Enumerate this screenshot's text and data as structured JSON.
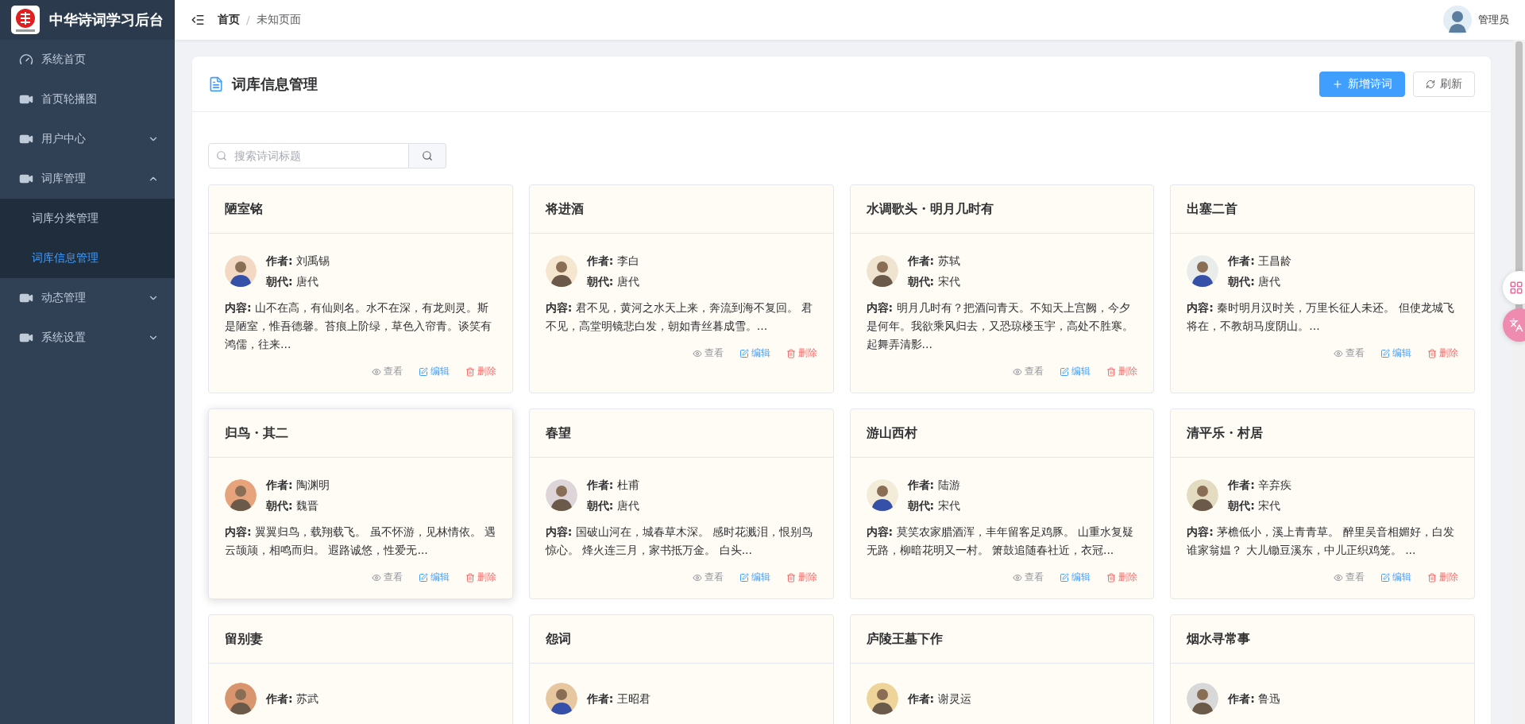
{
  "sidebar": {
    "logo_text": "中华诗词学习后台",
    "items": [
      {
        "label": "系统首页",
        "selected": false
      },
      {
        "label": "首页轮播图",
        "selected": false
      },
      {
        "label": "用户中心",
        "expanded": false,
        "selected": false
      },
      {
        "label": "词库管理",
        "expanded": true,
        "selected": false,
        "children": [
          {
            "label": "词库分类管理",
            "selected": false
          },
          {
            "label": "词库信息管理",
            "selected": true
          }
        ]
      },
      {
        "label": "动态管理",
        "expanded": false,
        "selected": false
      },
      {
        "label": "系统设置",
        "expanded": false,
        "selected": false
      }
    ]
  },
  "header": {
    "breadcrumb": [
      "首页",
      "未知页面"
    ],
    "separator": "/",
    "user": "管理员"
  },
  "panel": {
    "title": "词库信息管理",
    "buttons": [
      {
        "kind": "primary",
        "label": "新增诗词"
      },
      {
        "kind": "default",
        "label": "刷新"
      }
    ],
    "search": {
      "placeholder": "搜索诗词标题"
    },
    "cards": [
      {
        "title": "陋室铭",
        "hovered": false,
        "author": "**作者:** 刘禹锡",
        "dynasty": "**朝代:** 唐代",
        "content": "**内容:** 山不在高，有仙则名。水不在深，有龙则灵。斯是陋室，惟吾德馨。苔痕上阶绿，草色入帘青。谈笑有鸿儒，往来...",
        "actions": [
          {
            "kind": "view",
            "label": "查看"
          },
          {
            "kind": "edit",
            "label": "编辑"
          },
          {
            "kind": "delete",
            "label": "删除"
          }
        ]
      },
      {
        "title": "将进酒",
        "hovered": false,
        "author": "**作者:** 李白",
        "dynasty": "**朝代:** 唐代",
        "content": "**内容:** 君不见，黄河之水天上来，奔流到海不复回。 君不见，高堂明镜悲白发，朝如青丝暮成雪。...",
        "actions": [
          {
            "kind": "view",
            "label": "查看"
          },
          {
            "kind": "edit",
            "label": "编辑"
          },
          {
            "kind": "delete",
            "label": "删除"
          }
        ]
      },
      {
        "title": "水调歌头・明月几时有",
        "hovered": false,
        "author": "**作者:** 苏轼",
        "dynasty": "**朝代:** 宋代",
        "content": "**内容:** 明月几时有？把酒问青天。不知天上宫阙，今夕是何年。我欲乘风归去，又恐琼楼玉宇，高处不胜寒。起舞弄清影...",
        "actions": [
          {
            "kind": "view",
            "label": "查看"
          },
          {
            "kind": "edit",
            "label": "编辑"
          },
          {
            "kind": "delete",
            "label": "删除"
          }
        ]
      },
      {
        "title": "出塞二首",
        "hovered": false,
        "author": "**作者:** 王昌龄",
        "dynasty": "**朝代:** 唐代",
        "content": "**内容:** 秦时明月汉时关，万里长征人未还。 但使龙城飞将在，不教胡马度阴山。...",
        "actions": [
          {
            "kind": "view",
            "label": "查看"
          },
          {
            "kind": "edit",
            "label": "编辑"
          },
          {
            "kind": "delete",
            "label": "删除"
          }
        ]
      },
      {
        "title": "归鸟・其二",
        "hovered": true,
        "author": "**作者:** 陶渊明",
        "dynasty": "**朝代:** 魏晋",
        "content": "**内容:** 翼翼归鸟，载翔载飞。 虽不怀游，见林情依。 遇云颉颃，相鸣而归。 遐路诚悠，性爱无...",
        "actions": [
          {
            "kind": "view",
            "label": "查看"
          },
          {
            "kind": "edit",
            "label": "编辑"
          },
          {
            "kind": "delete",
            "label": "删除"
          }
        ]
      },
      {
        "title": "春望",
        "hovered": false,
        "author": "**作者:** 杜甫",
        "dynasty": "**朝代:** 唐代",
        "content": "**内容:** 国破山河在，城春草木深。 感时花溅泪，恨别鸟惊心。 烽火连三月，家书抵万金。 白头...",
        "actions": [
          {
            "kind": "view",
            "label": "查看"
          },
          {
            "kind": "edit",
            "label": "编辑"
          },
          {
            "kind": "delete",
            "label": "删除"
          }
        ]
      },
      {
        "title": "游山西村",
        "hovered": false,
        "author": "**作者:** 陆游",
        "dynasty": "**朝代:** 宋代",
        "content": "**内容:** 莫笑农家腊酒浑，丰年留客足鸡豚。 山重水复疑无路，柳暗花明又一村。 箫鼓追随春社近，衣冠...",
        "actions": [
          {
            "kind": "view",
            "label": "查看"
          },
          {
            "kind": "edit",
            "label": "编辑"
          },
          {
            "kind": "delete",
            "label": "删除"
          }
        ]
      },
      {
        "title": "清平乐・村居",
        "hovered": false,
        "author": "**作者:** 辛弃疾",
        "dynasty": "**朝代:** 宋代",
        "content": "**内容:** 茅檐低小，溪上青青草。 醉里吴音相媚好，白发谁家翁媪？ 大儿锄豆溪东，中儿正织鸡笼。 ...",
        "actions": [
          {
            "kind": "view",
            "label": "查看"
          },
          {
            "kind": "edit",
            "label": "编辑"
          },
          {
            "kind": "delete",
            "label": "删除"
          }
        ]
      },
      {
        "title": "留别妻",
        "hovered": false,
        "author": "**作者:** 苏武"
      },
      {
        "title": "怨词",
        "hovered": false,
        "author": "**作者:** 王昭君"
      },
      {
        "title": "庐陵王墓下作",
        "hovered": false,
        "author": "**作者:** 谢灵运"
      },
      {
        "title": "烟水寻常事",
        "hovered": false,
        "author": "**作者:** 鲁迅"
      }
    ]
  }
}
